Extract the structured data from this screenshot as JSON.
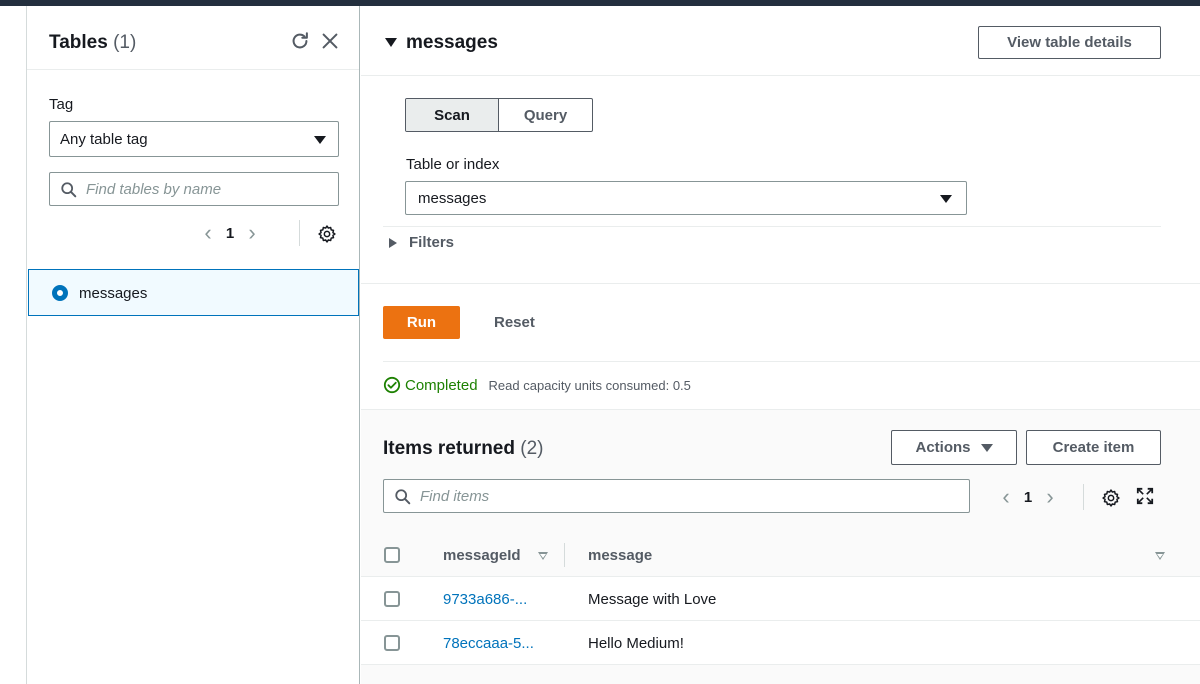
{
  "left_panel": {
    "title": "Tables",
    "count": "(1)",
    "tag_label": "Tag",
    "tag_value": "Any table tag",
    "search_placeholder": "Find tables by name",
    "page": "1",
    "tables": [
      {
        "name": "messages",
        "selected": true
      }
    ]
  },
  "main": {
    "table_title": "messages",
    "view_details_label": "View table details",
    "tabs": [
      {
        "label": "Scan",
        "active": true
      },
      {
        "label": "Query",
        "active": false
      }
    ],
    "table_or_index_label": "Table or index",
    "table_or_index_value": "messages",
    "filters_label": "Filters",
    "run_label": "Run",
    "reset_label": "Reset",
    "status": "Completed",
    "rcu_text": "Read capacity units consumed: 0.5"
  },
  "items": {
    "title": "Items returned",
    "count": "(2)",
    "actions_label": "Actions",
    "create_label": "Create item",
    "search_placeholder": "Find items",
    "page": "1",
    "columns": [
      "messageId",
      "message"
    ],
    "rows": [
      {
        "id": "9733a686-...",
        "message": "Message with Love"
      },
      {
        "id": "78eccaaa-5...",
        "message": "Hello Medium!"
      }
    ]
  },
  "colors": {
    "accent": "#0073bb",
    "run": "#ec7211",
    "success": "#1d8102",
    "topbar": "#232f3e"
  }
}
